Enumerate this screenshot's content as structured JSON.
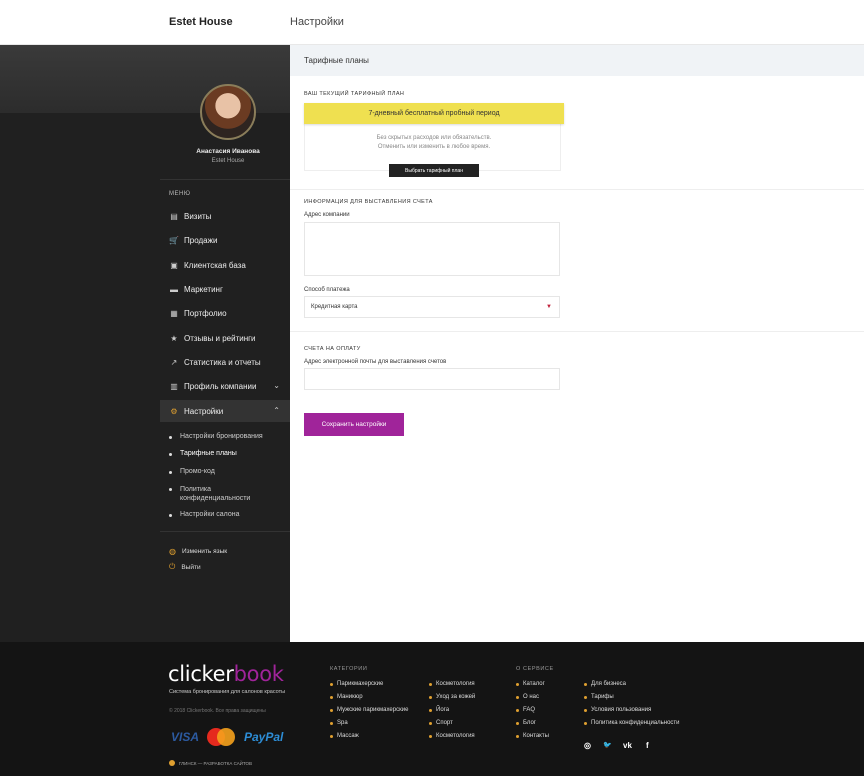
{
  "header": {
    "brand": "Estet House",
    "page": "Настройки"
  },
  "user": {
    "name": "Анастасия Иванова",
    "company": "Estet House"
  },
  "menu": {
    "title": "МЕНЮ",
    "items": [
      {
        "label": "Визиты",
        "icon": "clipboard-icon"
      },
      {
        "label": "Продажи",
        "icon": "cart-icon"
      },
      {
        "label": "Клиентская база",
        "icon": "contacts-icon"
      },
      {
        "label": "Маркетинг",
        "icon": "briefcase-icon"
      },
      {
        "label": "Портфолио",
        "icon": "gallery-icon"
      },
      {
        "label": "Отзывы и рейтинги",
        "icon": "star-icon"
      },
      {
        "label": "Статистика и отчеты",
        "icon": "chart-icon"
      },
      {
        "label": "Профиль компании",
        "icon": "profile-icon"
      },
      {
        "label": "Настройки",
        "icon": "gear-icon"
      }
    ],
    "sub": [
      {
        "label": "Настройки бронирования"
      },
      {
        "label": "Тарифные планы"
      },
      {
        "label": "Промо-код"
      },
      {
        "label": "Политика конфиденциальности"
      },
      {
        "label": "Настройки салона"
      }
    ],
    "change_lang": "Изменить язык",
    "logout": "Выйти"
  },
  "main": {
    "title": "Тарифные планы",
    "plan": {
      "section": "ВАШ ТЕКУЩИЙ ТАРИФНЫЙ ПЛАН",
      "current": "7-дневный бесплатный пробный период",
      "note1": "Без скрытых расходов или обязательств.",
      "note2": "Отменить или изменить в любое время.",
      "button": "Выбрать тарифный план"
    },
    "billing": {
      "section": "ИНФОРМАЦИЯ ДЛЯ ВЫСТАВЛЕНИЯ СЧЕТА",
      "address_label": "Адрес компании",
      "address_value": "",
      "payment_label": "Способ платежа",
      "payment_value": "Кредитная карта"
    },
    "invoices": {
      "section": "СЧЕТА НА ОПЛАТУ",
      "email_label": "Адрес электронной почты для выставления счетов",
      "email_value": ""
    },
    "save": "Сохранить настройки"
  },
  "footer": {
    "logo_a": "clicker",
    "logo_b": "book",
    "tagline": "Система бронирования для салонов красоты",
    "copyright": "© 2018 Clickerbook. Все права защищены",
    "payments": [
      "VISA",
      "MasterCard",
      "PayPal"
    ],
    "developer": "ГЛИНСК — РАЗРАБОТКА САЙТОВ",
    "categories_title": "КАТЕГОРИИ",
    "categories_col1": [
      "Парикмахерские",
      "Маникюр",
      "Мужские парикмахерские",
      "Spa",
      "Массаж"
    ],
    "categories_col2": [
      "Косметология",
      "Уход за кожей",
      "Йога",
      "Спорт",
      "Косметология"
    ],
    "about_title": "О СЕРВИСЕ",
    "about_col1": [
      "Каталог",
      "О нас",
      "FAQ",
      "Блог",
      "Контакты"
    ],
    "about_col2": [
      "Для бизнеса",
      "Тарифы",
      "Условия пользования",
      "Политика конфиденциальности"
    ],
    "social": [
      {
        "icon": "instagram-icon",
        "glyph": "◎"
      },
      {
        "icon": "twitter-icon",
        "glyph": "🐦"
      },
      {
        "icon": "vk-icon",
        "glyph": "vk"
      },
      {
        "icon": "facebook-icon",
        "glyph": "f"
      }
    ]
  },
  "colors": {
    "accent": "#a0249a",
    "plan_banner": "#efe050",
    "sidebar": "#202020",
    "gear": "#e0a030"
  }
}
